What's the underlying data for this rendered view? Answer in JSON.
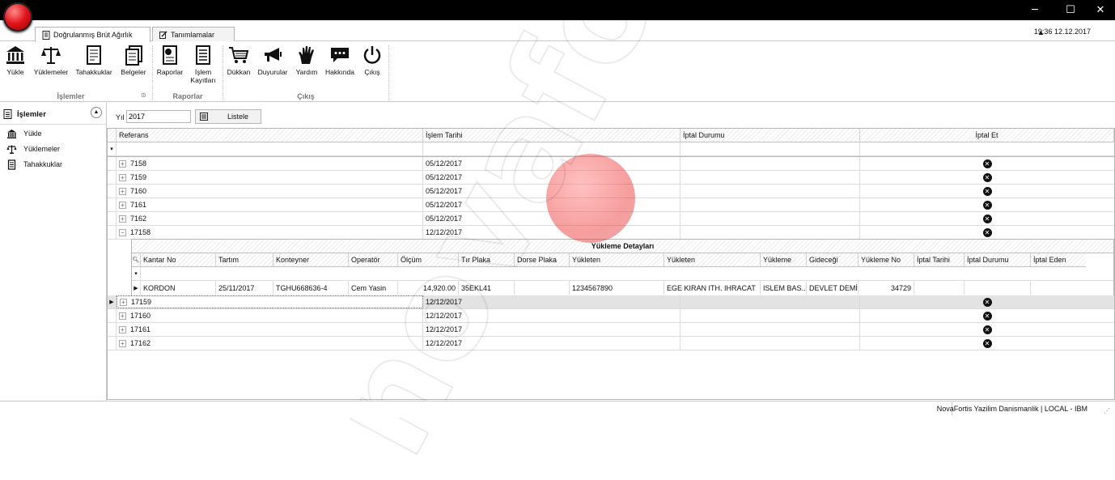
{
  "window": {
    "minimize": "─",
    "maximize": "☐",
    "close": "✕"
  },
  "tabs": [
    {
      "label": "Doğrulanmış Brüt Ağırlık"
    },
    {
      "label": "Tanımlamalar"
    }
  ],
  "clock": "19:36 12.12.2017",
  "collapse_glyph": "▲",
  "ribbon": {
    "buttons": [
      {
        "label": "Yükle",
        "icon": "bank-icon"
      },
      {
        "label": "Yüklemeler",
        "icon": "scale-icon"
      },
      {
        "label": "Tahakkuklar",
        "icon": "document-icon"
      },
      {
        "label": "Belgeler",
        "icon": "documents-icon"
      },
      {
        "label": "Raporlar",
        "icon": "report-icon"
      },
      {
        "label": "İşlem Kayıtları",
        "icon": "log-icon"
      },
      {
        "label": "Dükkan",
        "icon": "cart-icon"
      },
      {
        "label": "Duyurular",
        "icon": "megaphone-icon"
      },
      {
        "label": "Yardım",
        "icon": "hand-icon"
      },
      {
        "label": "Hakkında",
        "icon": "chat-icon"
      },
      {
        "label": "Çıkış",
        "icon": "power-icon"
      }
    ],
    "groups": [
      "İşlemler",
      "Raporlar",
      "Çıkış"
    ]
  },
  "nav": {
    "title": "İşlemler",
    "items": [
      "Yükle",
      "Yüklemeler",
      "Tahakkuklar"
    ]
  },
  "filter": {
    "label": "Yıl",
    "value": "2017",
    "button": "Listele"
  },
  "grid": {
    "headers": [
      "Referans",
      "İşlem Tarihi",
      "İptal Durumu",
      "İptal Et"
    ],
    "filter_glyph": "▾",
    "rows_top": [
      {
        "ref": "7158",
        "date": "05/12/2017"
      },
      {
        "ref": "7159",
        "date": "05/12/2017"
      },
      {
        "ref": "7160",
        "date": "05/12/2017"
      },
      {
        "ref": "7161",
        "date": "05/12/2017"
      },
      {
        "ref": "7162",
        "date": "05/12/2017"
      },
      {
        "ref": "17158",
        "date": "12/12/2017"
      }
    ],
    "detail": {
      "title": "Yükleme Detayları",
      "headers": [
        "Kantar No",
        "Tartım",
        "Konteyner",
        "Operatör",
        "Ölçüm",
        "Tır Plaka",
        "Dorse Plaka",
        "Yükleten",
        "Yükleten",
        "Yükleme",
        "Gideceği",
        "Yükleme No",
        "İptal Tarihi",
        "İptal Durumu",
        "İptal Eden"
      ],
      "row": [
        "KORDON",
        "25/11/2017",
        "TGHU668636-4",
        "Cem Yasin",
        "14,920.00",
        "35EKL41",
        "",
        "1234567890",
        "EGE KIRAN ITH. IHRACAT",
        "ISLEM BAS...",
        "DEVLET DEMİRYOLL...",
        "34729",
        "",
        "",
        ""
      ]
    },
    "rows_bottom": [
      {
        "ref": "17159",
        "date": "12/12/2017"
      },
      {
        "ref": "17160",
        "date": "12/12/2017"
      },
      {
        "ref": "17161",
        "date": "12/12/2017"
      },
      {
        "ref": "17162",
        "date": "12/12/2017"
      }
    ],
    "cancel_glyph": "✕",
    "plus": "+",
    "minus": "−"
  },
  "status": "NovaFortis Yazilim Danismanlik | LOCAL - IBM",
  "watermark": "novafortis"
}
